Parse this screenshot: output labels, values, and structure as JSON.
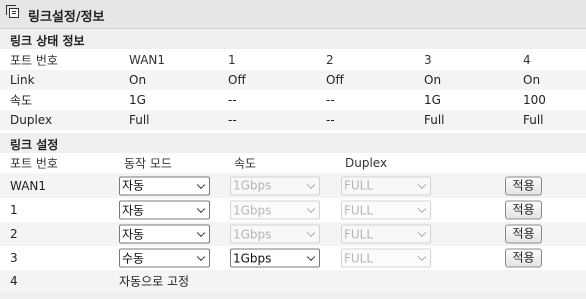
{
  "title": "링크설정/정보",
  "status_section": {
    "title": "링크 상태 정보",
    "columns": [
      "포트 번호",
      "WAN1",
      "1",
      "2",
      "3",
      "4"
    ],
    "rows": [
      {
        "label": "Link",
        "values": [
          "On",
          "Off",
          "Off",
          "On",
          "On"
        ]
      },
      {
        "label": "속도",
        "values": [
          "1G",
          "--",
          "--",
          "1G",
          "100"
        ]
      },
      {
        "label": "Duplex",
        "values": [
          "Full",
          "--",
          "--",
          "Full",
          "Full"
        ]
      }
    ]
  },
  "config_section": {
    "title": "링크 설정",
    "columns": [
      "포트 번호",
      "동작 모드",
      "속도",
      "Duplex"
    ],
    "apply_label": "적용",
    "rows": [
      {
        "port": "WAN1",
        "mode": "자동",
        "speed": "1Gbps",
        "duplex": "FULL"
      },
      {
        "port": "1",
        "mode": "자동",
        "speed": "1Gbps",
        "duplex": "FULL"
      },
      {
        "port": "2",
        "mode": "자동",
        "speed": "1Gbps",
        "duplex": "FULL"
      },
      {
        "port": "3",
        "mode": "수동",
        "speed": "1Gbps",
        "duplex": "FULL"
      }
    ],
    "fixed_row": {
      "port": "4",
      "text": "자동으로 고정"
    }
  }
}
